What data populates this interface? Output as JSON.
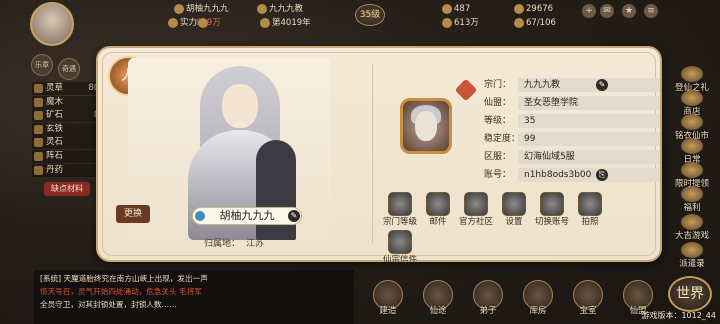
{
  "top_bar": {
    "player_name": "胡柚九九九",
    "power_label": "实力",
    "power_value": "829万",
    "sect_name": "九九九教",
    "days": "第4019年",
    "level": "35级",
    "res_a": "487",
    "res_b": "29676",
    "res_c": "613万",
    "res_d": "67/106"
  },
  "resources": [
    {
      "label": "灵草",
      "value": "8085"
    },
    {
      "label": "魔木",
      "value": "4"
    },
    {
      "label": "矿石",
      "value": "893"
    },
    {
      "label": "玄铁",
      "value": "89"
    },
    {
      "label": "灵石",
      "value": ""
    },
    {
      "label": "阵石",
      "value": ""
    },
    {
      "label": "丹药",
      "value": ""
    }
  ],
  "lack_button": "缺点材料",
  "left_small": [
    "乐章",
    "奇遇"
  ],
  "right_menu": [
    "登仙之礼",
    "商店",
    "铭衣仙市",
    "日常",
    "限时提领",
    "福利",
    "大吉游戏",
    "派遣录"
  ],
  "chat": {
    "line1": "[系统] 天魔道胎终究在南方山峡上出现，发出一声",
    "line2": "惊天号召，灵气开始四处涌动，危急关头 毛将军",
    "line3": "全员守卫，对其封锁处置，封锁人数……",
    "label": "仙友"
  },
  "bottom_menu": [
    "建造",
    "仙途",
    "弟子",
    "库房",
    "宝室",
    "仙盟"
  ],
  "world_btn": "世界",
  "version": "游戏版本：1012_44",
  "dialog": {
    "tab_label": "人",
    "name": "胡柚九九九",
    "seal_label": "更换",
    "home_label": "归属地：",
    "home_value": "江苏",
    "info": [
      {
        "label": "宗门：",
        "value": "九九九教"
      },
      {
        "label": "仙盟：",
        "value": "圣女恶堕学院"
      },
      {
        "label": "等级：",
        "value": "35"
      },
      {
        "label": "稳定度：",
        "value": "99"
      },
      {
        "label": "区服：",
        "value": "幻海仙域5服"
      },
      {
        "label": "账号：",
        "value": "n1hb8ods3b00"
      }
    ],
    "functions": [
      "宗门等级",
      "邮件",
      "官方社区",
      "设置",
      "切换账号",
      "拍照",
      "仙宗信件"
    ]
  }
}
